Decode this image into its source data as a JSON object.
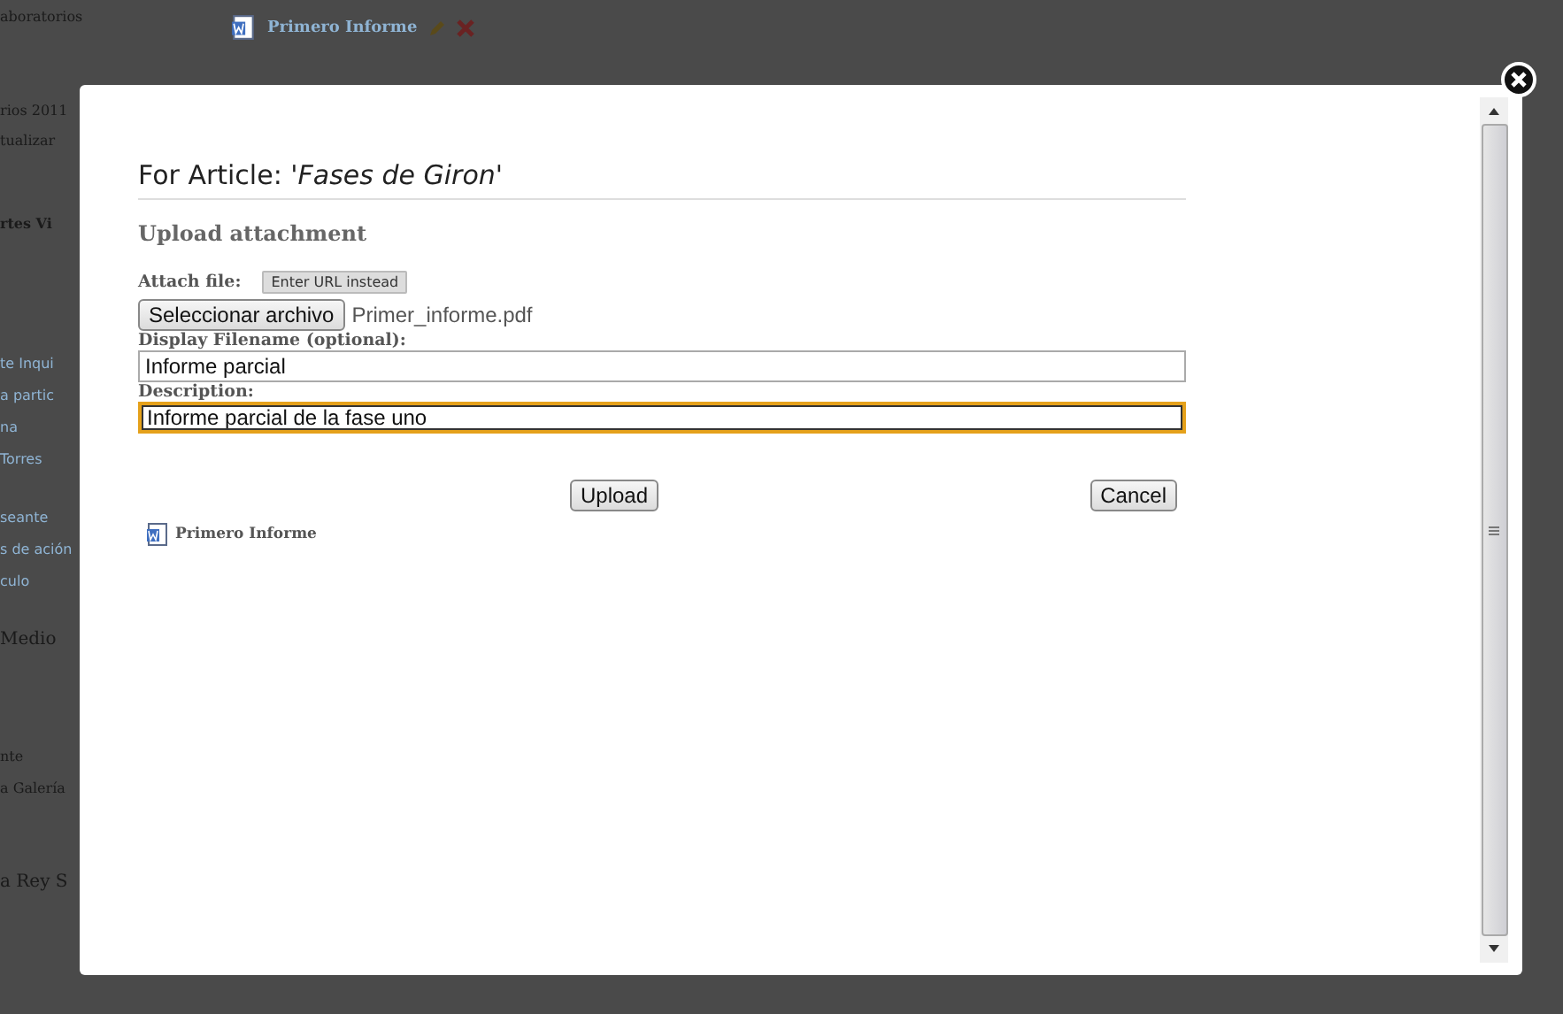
{
  "background": {
    "sidebar_items": [
      {
        "label": "aboratorios",
        "kind": "text"
      },
      {
        "label": "rios 2011",
        "kind": "text"
      },
      {
        "label": "tualizar",
        "kind": "text"
      },
      {
        "label": "rtes Vi",
        "kind": "heading"
      },
      {
        "label": "te Inqui",
        "kind": "link"
      },
      {
        "label": "a partic",
        "kind": "link"
      },
      {
        "label": "na",
        "kind": "link"
      },
      {
        "label": "Torres",
        "kind": "link"
      },
      {
        "label": "seante",
        "kind": "link"
      },
      {
        "label": "s de ación",
        "kind": "link"
      },
      {
        "label": "culo",
        "kind": "link"
      },
      {
        "label": "Medio",
        "kind": "large"
      },
      {
        "label": "nte",
        "kind": "text"
      },
      {
        "label": "a Galería",
        "kind": "text"
      },
      {
        "label": "a Rey S",
        "kind": "large"
      }
    ],
    "attachment": {
      "label": "Primero Informe"
    }
  },
  "dialog": {
    "title": "For Article: *'Fases de Giron'*",
    "section": "Upload attachment",
    "attach_label": "Attach file:",
    "url_button": "Enter URL instead",
    "file_button": "Seleccionar archivo",
    "file_name": "Primer_informe.pdf",
    "filename_label": "Display Filename (optional):",
    "filename_value": "Informe parcial",
    "description_label": "Description:",
    "description_value": "Informe parcial de la fase uno",
    "description_focused": true,
    "upload_button": "Upload",
    "cancel_button": "Cancel",
    "attachments": [
      {
        "label": "Primero Informe"
      }
    ]
  }
}
